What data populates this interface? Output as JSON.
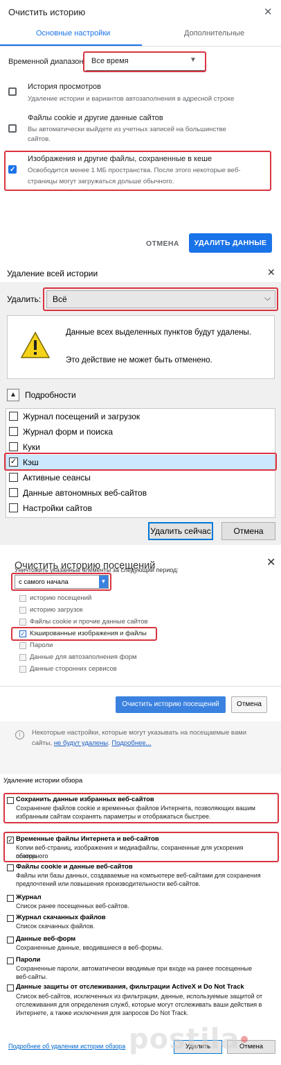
{
  "chrome": {
    "title": "Очистить историю",
    "tabs": [
      "Основные настройки",
      "Дополнительные"
    ],
    "range_label": "Временной диапазон",
    "range_value": "Все время",
    "items": [
      {
        "title": "История просмотров",
        "desc": [
          "Удаление истории и вариантов автозаполнения в адресной строке"
        ],
        "checked": false
      },
      {
        "title": "Файлы cookie и другие данные сайтов",
        "desc": [
          "Вы автоматически выйдете из учетных записей на большинстве",
          "сайтов."
        ],
        "checked": false
      },
      {
        "title": "Изображения и другие файлы, сохраненные в кеше",
        "desc": [
          "Освободится менее 1 МБ пространства. После этого некоторые веб-",
          "страницы могут загружаться дольше обычного."
        ],
        "checked": true
      }
    ],
    "cancel": "ОТМЕНА",
    "delete": "УДАЛИТЬ ДАННЫЕ",
    "accent": "#1a73e8"
  },
  "firefox": {
    "title": "Удаление всей истории",
    "delete_label": "Удалить:",
    "delete_value": "Всё",
    "warning_line1": "Данные всех выделенных пунктов будут удалены.",
    "warning_line2": "Это действие не может быть отменено.",
    "details": "Подробности",
    "items": [
      {
        "label": "Журнал посещений и загрузок",
        "checked": false
      },
      {
        "label": "Журнал форм и поиска",
        "checked": false
      },
      {
        "label": "Куки",
        "checked": false
      },
      {
        "label": "Кэш",
        "checked": true
      },
      {
        "label": "Активные сеансы",
        "checked": false
      },
      {
        "label": "Данные автономных веб-сайтов",
        "checked": false
      },
      {
        "label": "Настройки сайтов",
        "checked": false
      }
    ],
    "delete_now": "Удалить сейчас",
    "cancel": "Отмена"
  },
  "opera": {
    "title": "Очистить историю посещений",
    "period_label": "Уничтожить указанные элементы за следующий период:",
    "period_value": "с самого начала",
    "items": [
      {
        "label": "историю посещений",
        "checked": false
      },
      {
        "label": "историю загрузок",
        "checked": false
      },
      {
        "label": "Файлы cookie и прочие данные сайтов",
        "checked": false
      },
      {
        "label": "Кэшированные изображения и файлы",
        "checked": true
      },
      {
        "label": "Пароли",
        "checked": false
      },
      {
        "label": "Данные для автозаполнения форм",
        "checked": false
      },
      {
        "label": "Данные сторонних сервисов",
        "checked": false
      }
    ],
    "clear_button": "Очистить историю посещений",
    "cancel": "Отмена",
    "note_line1": "Некоторые настройки, которые могут указывать на посещаемые вами",
    "note_line2_pre": "сайты, ",
    "note_link1": "не будут удалены",
    "note_line2_mid": ". ",
    "note_link2": "Подробнее..."
  },
  "ie": {
    "title": "Удаление истории обзора",
    "items": [
      {
        "title": "Сохранить данные избранных веб-сайтов",
        "desc": [
          "Сохранение файлов cookie и временных файлов Интернета, позволяющих вашим",
          "избранным сайтам сохранять параметры и отображаться быстрее."
        ],
        "checked": false
      },
      {
        "title": "Временные файлы Интернета и веб-сайтов",
        "desc": [
          "Копии веб-страниц, изображения и медиафайлы, сохраненные для ускорения повторного",
          "обзора."
        ],
        "checked": true
      },
      {
        "title": "Файлы cookie и данные веб-сайтов",
        "desc": [
          "Файлы или базы данных, создаваемые на компьютере веб-сайтами для сохранения",
          "предпочтений или повышения производительности веб-сайтов."
        ],
        "checked": false
      },
      {
        "title": "Журнал",
        "desc": [
          "Список ранее посещенных веб-сайтов."
        ],
        "checked": false
      },
      {
        "title": "Журнал скачанных файлов",
        "desc": [
          "Список скачанных файлов."
        ],
        "checked": false
      },
      {
        "title": "Данные веб-форм",
        "desc": [
          "Сохраненные данные, вводившиеся в веб-формы."
        ],
        "checked": false
      },
      {
        "title": "Пароли",
        "desc": [
          "Сохраненные пароли, автоматически вводимые при входе на ранее посещенные",
          "веб-сайты."
        ],
        "checked": false
      },
      {
        "title": "Данные защиты от отслеживания, фильтрации ActiveX и Do Not Track",
        "desc": [
          "Список веб-сайтов, исключенных из фильтрации, данные, используемые защитой от",
          "отслеживания для определения служб, которые могут отслеживать ваши действия в",
          "Интернете, а также исключения для запросов Do Not Track."
        ],
        "checked": false
      }
    ],
    "link": "Подробнее об удалении истории обзора",
    "delete": "Удалить",
    "cancel": "Отмена"
  },
  "watermark": "postila.ru",
  "highlight_color": "#d9333f"
}
